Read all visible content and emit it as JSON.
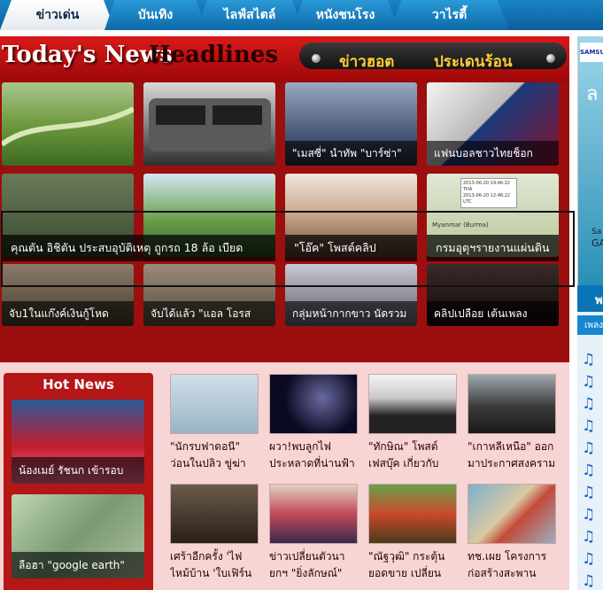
{
  "tabs": [
    "ข่าวเด่น",
    "บันเทิง",
    "ไลฟ์สไตล์",
    "หนังชนโรง",
    "วาไรตี้"
  ],
  "banner": {
    "todays": "Today's News",
    "headlines": "Headlines",
    "hot": "ข่าวฮอต",
    "hot_topic": "ประเดนร้อน"
  },
  "grid_captions": {
    "tile_3": "\"เมสซี่\" นำทัพ \"บาร์ซ่า\"",
    "tile_4": "แฟนบอลชาวไทยช็อก",
    "overlay_1": "คุณตัน อิชิตัน ประสบอุบัติเหตุ ถูกรถ 18 ล้อ เบียด",
    "overlay_2": "\"โอ๊ค\" โพสต์คลิป",
    "overlay_3": "กรมอุตุฯรายงานแผ่นดิน",
    "tile_9": "จับ1ในแก๊งค์เงินกู้โหด",
    "tile_10": "จับได้แล้ว \"แอล โอรส",
    "tile_11": "กลุ่มหน้ากากขาว นัดรวม",
    "tile_12": "คลิปเปลือย เต้นเพลง"
  },
  "map_text": {
    "line1": "2013-06-20 19:46:22 THA",
    "line2": "2013-06-20 12:46:22 UTC",
    "line3": "Myanmar (Burma)"
  },
  "hot_news": {
    "title": "Hot News",
    "items": [
      "น้องเมย์ รัชนก เข้ารอบ",
      "ลือฮา \"google earth\""
    ]
  },
  "news_grid": [
    [
      "\"นักรบฟาดอนี\"",
      "ว่อนในปลิว ขู่ฆ่า"
    ],
    [
      "ผวา!พบลูกไฟ",
      "ประหลาดที่น่านฟ้า"
    ],
    [
      "\"ทักษิณ\" โพสต์",
      "เฟสบุ๊ค เกี่ยวกับ"
    ],
    [
      "\"เกาหลีเหนือ\" ออก",
      "มาประกาศสงคราม"
    ],
    [
      "เศร้าอีกครั้ง 'ไฟ",
      "ไหม้บ้าน 'ใบเฟิร์น"
    ],
    [
      "ข่าวเปลี่ยนตัวนา",
      "ยกฯ \"ยิ่งลักษณ์\""
    ],
    [
      "\"ณัฐวุฒิ\" กระตุ้น",
      "ยอดขาย เปลี่ยน"
    ],
    [
      "ทช.เผย โครงการ",
      "ก่อสร้างสะพาน"
    ]
  ],
  "right": {
    "samsung": "SAMSUNG",
    "ad_1": "ล",
    "ad_2": "Sa",
    "ad_3": "GA",
    "music_head": "พ",
    "music_sub": "เพลง"
  },
  "colors": {
    "tab_blue": "#0e6aa8",
    "red": "#9b0f0f",
    "pink": "#f7d5d5",
    "note": "#1a64c9"
  }
}
